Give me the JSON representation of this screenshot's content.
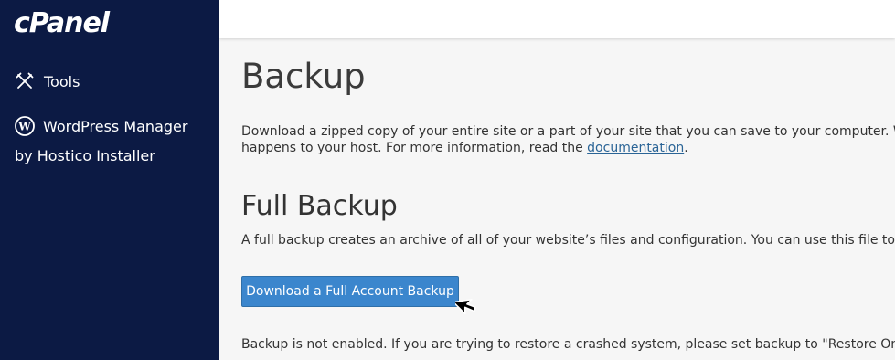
{
  "app": {
    "logo_text": "cPanel"
  },
  "colors": {
    "sidebar_bg": "#0c1a44",
    "primary_button": "#3b86cd",
    "link": "#2a6496",
    "content_bg": "#f6f6f6"
  },
  "sidebar": {
    "items": [
      {
        "label": "Tools",
        "icon": "tools-icon"
      },
      {
        "label_line1": "WordPress Manager",
        "label_line2": "by Hostico Installer",
        "icon": "wordpress-icon"
      }
    ]
  },
  "main": {
    "title": "Backup",
    "intro_line1": "Download a zipped copy of your entire site or a part of your site that you can save to your computer. When yo",
    "intro_line2_prefix": "happens to your host. For more information, read the ",
    "intro_link": "documentation",
    "intro_line2_suffix": ".",
    "full_backup": {
      "title": "Full Backup",
      "description": "A full backup creates an archive of all of your website’s files and configuration. You can use this file to move yo",
      "button_label": "Download a Full Account Backup"
    },
    "status_message": "Backup is not enabled. If you are trying to restore a crashed system, please set backup to \"Restore Only\""
  }
}
